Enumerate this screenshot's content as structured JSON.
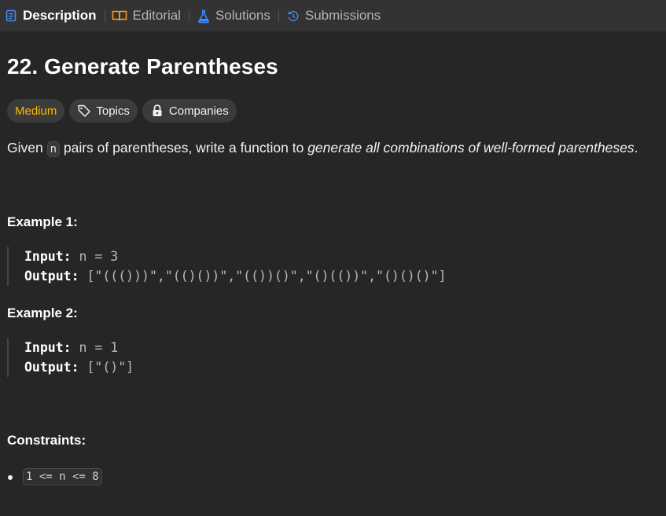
{
  "tabs": [
    {
      "label": "Description",
      "icon": "description-icon",
      "active": true
    },
    {
      "label": "Editorial",
      "icon": "book-icon",
      "active": false
    },
    {
      "label": "Solutions",
      "icon": "flask-icon",
      "active": false
    },
    {
      "label": "Submissions",
      "icon": "history-icon",
      "active": false
    }
  ],
  "problem": {
    "title": "22. Generate Parentheses",
    "difficulty": "Medium",
    "topics_label": "Topics",
    "companies_label": "Companies",
    "desc_prefix": "Given ",
    "desc_code": "n",
    "desc_middle": " pairs of parentheses, write a function to ",
    "desc_emph": "generate all combinations of well-formed parentheses",
    "desc_suffix": "."
  },
  "examples": [
    {
      "heading": "Example 1:",
      "input_label": "Input:",
      "input_value": " n = 3",
      "output_label": "Output:",
      "output_value": " [\"((()))\",\"(()())\",\"(())()\",\"()(())\",\"()()()\"]"
    },
    {
      "heading": "Example 2:",
      "input_label": "Input:",
      "input_value": " n = 1",
      "output_label": "Output:",
      "output_value": " [\"()\"]"
    }
  ],
  "constraints": {
    "heading": "Constraints:",
    "items": [
      "1 <= n <= 8"
    ]
  },
  "colors": {
    "background": "#262626",
    "tabbar": "#333333",
    "medium": "#ffb800",
    "accent_blue": "#3f8cff"
  }
}
